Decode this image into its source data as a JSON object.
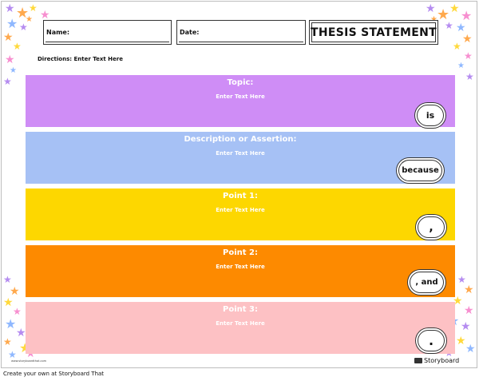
{
  "header": {
    "name_label": "Name:",
    "date_label": "Date:",
    "title": "THESIS STATEMENT"
  },
  "directions": {
    "label": "Directions:",
    "value": "Enter Text Here"
  },
  "bands": [
    {
      "title": "Topic:",
      "placeholder": "Enter Text Here",
      "connector": "is",
      "color": "#cf8df6"
    },
    {
      "title": "Description or Assertion:",
      "placeholder": "Enter Text Here",
      "connector": "because",
      "color": "#a6c1f5"
    },
    {
      "title": "Point 1:",
      "placeholder": "Enter Text Here",
      "connector": ",",
      "color": "#fdd700"
    },
    {
      "title": "Point 2:",
      "placeholder": "Enter Text Here",
      "connector": ", and",
      "color": "#fd8a00"
    },
    {
      "title": "Point 3:",
      "placeholder": "Enter Text Here",
      "connector": ".",
      "color": "#fdc1c4"
    }
  ],
  "footer": {
    "site": "www.storyboardthat.com",
    "brand": "Storyboard",
    "caption": "Create your own at Storyboard That"
  },
  "decoration": {
    "star_colors": [
      "#ffd93b",
      "#f78fd0",
      "#8fb8ff",
      "#b58cf0",
      "#ffa94d"
    ]
  }
}
